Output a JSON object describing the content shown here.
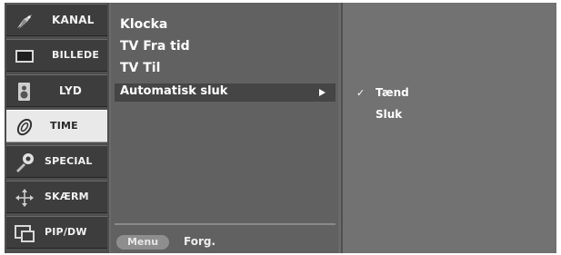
{
  "sidebar": {
    "items": [
      {
        "label": "KANAL",
        "icon": "satellite-dish-icon",
        "active": false
      },
      {
        "label": "BILLEDE",
        "icon": "tv-screen-icon",
        "active": false
      },
      {
        "label": "LYD",
        "icon": "speaker-icon",
        "active": false
      },
      {
        "label": "TIME",
        "icon": "clock-icon",
        "active": true
      },
      {
        "label": "SPECIAL",
        "icon": "wrench-icon",
        "active": false
      },
      {
        "label": "SKÆRM",
        "icon": "cross-arrows-icon",
        "active": false
      },
      {
        "label": "PIP/DW",
        "icon": "picture-in-picture-icon",
        "active": false
      }
    ]
  },
  "submenu": {
    "items": [
      "Klocka",
      "TV Fra tid",
      "TV Til"
    ],
    "selected": "Automatisk sluk"
  },
  "options": {
    "items": [
      "Tænd",
      "Sluk"
    ],
    "checked_index": 0,
    "check_mark": "✓"
  },
  "footer": {
    "menu_button": "Menu",
    "hint": "Forg."
  },
  "colors": {
    "panel_dark": "#3d3d3d",
    "active_item": "#e9e9e9",
    "text": "#ffffff"
  }
}
